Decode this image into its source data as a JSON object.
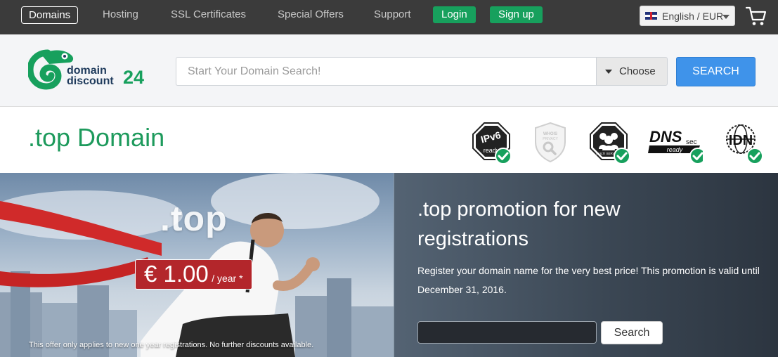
{
  "nav": {
    "items": [
      {
        "label": "Domains",
        "active": true
      },
      {
        "label": "Hosting"
      },
      {
        "label": "SSL Certificates"
      },
      {
        "label": "Special Offers"
      },
      {
        "label": "Support"
      }
    ],
    "login_label": "Login",
    "signup_label": "Sign up",
    "language": "English / EUR",
    "cart_icon": "cart-icon"
  },
  "header": {
    "logo": {
      "line1": "domain",
      "line2": "discount",
      "number": "24"
    },
    "search_placeholder": "Start Your Domain Search!",
    "choose_label": "Choose",
    "search_button": "SEARCH"
  },
  "page_title": ".top Domain",
  "features": [
    {
      "icon": "ipv6-ready-icon",
      "label": "ready",
      "supported": true
    },
    {
      "icon": "whois-privacy-icon",
      "label": "WHOIS PRIVACY",
      "supported": false
    },
    {
      "icon": "multiple-servers-icon",
      "supported": true
    },
    {
      "icon": "dnssec-ready-icon",
      "label": "DNS",
      "sup": "sec",
      "sub": "ready",
      "supported": true
    },
    {
      "icon": "idn-icon",
      "label": "IDN",
      "supported": true
    }
  ],
  "hero": {
    "tld": ".top",
    "price": "€ 1.00",
    "price_suffix": "/ year *",
    "offer_note": "This offer only applies to new one year registrations. No further discounts available.",
    "promo_title": ".top promotion for new registrations",
    "promo_text": "Register your domain name for the very best price! This promotion is valid until December 31, 2016.",
    "promo_search_button": "Search"
  },
  "colors": {
    "nav_bg": "#3b3b3b",
    "brand_green": "#17a05d",
    "accent_blue": "#3f93ea",
    "price_red": "#b3262b"
  }
}
